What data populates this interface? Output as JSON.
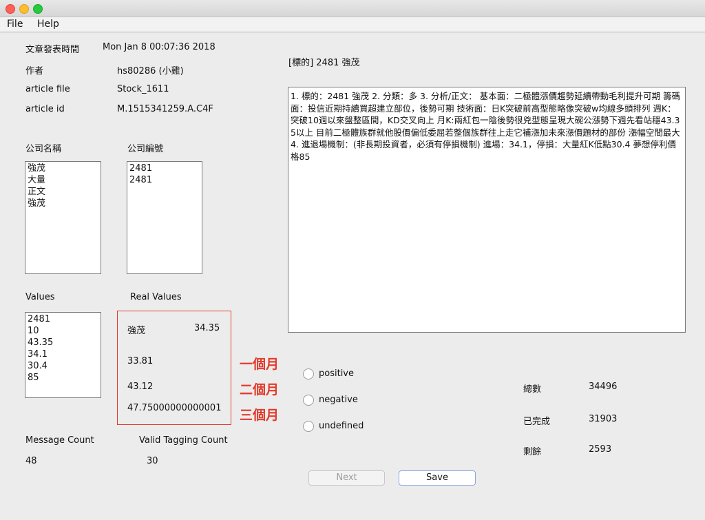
{
  "menu": {
    "file": "File",
    "help": "Help"
  },
  "meta": {
    "date_label": "文章發表時間",
    "date_value": "Mon Jan  8 00:07:36 2018",
    "author_label": "作者",
    "author_value": "hs80286 (小雞)",
    "file_label": "article file",
    "file_value": "Stock_1611",
    "id_label": "article id",
    "id_value": "M.1515341259.A.C4F"
  },
  "target": "[標的] 2481 強茂",
  "article_text": "1. 標的：2481 強茂 2. 分類：多 3. 分析/正文： 基本面：二極體漲價趨勢延續帶動毛利提升可期 籌碼面：投信近期持續買超建立部位，後勢可期 技術面：日K突破前高型態略像突破w均線多頭排列 週K：突破10週以來盤整區間，KD交叉向上 月K:兩紅包一陰後勢很兇型態呈現大碗公漲勢下週先看站穩43.35以上 目前二極體族群就他股價偏低委屈若整個族群往上走它補漲加未來漲價題材的部份 漲幅空間最大 4. 進退場機制：(非長期投資者，必須有停損機制) 進場：34.1，停損：大量紅K低點30.4 夢想停利價格85",
  "company_name_label": "公司名稱",
  "company_names": [
    "強茂",
    "大量",
    "正文",
    "強茂"
  ],
  "company_id_label": "公司編號",
  "company_ids": [
    "2481",
    "2481"
  ],
  "values_label": "Values",
  "values": [
    "2481",
    "10",
    "43.35",
    "34.1",
    "30.4",
    "85"
  ],
  "real_values_label": "Real Values",
  "real_values": {
    "company": "強茂",
    "base": "34.35",
    "month1": "33.81",
    "month2": "43.12",
    "month3": "47.75000000000001"
  },
  "annotations": {
    "month1": "一個月",
    "month2": "二個月",
    "month3": "三個月",
    "color": "#e23a2a"
  },
  "message_count_label": "Message Count",
  "message_count": "48",
  "valid_tagging_label": "Valid Tagging Count",
  "valid_tagging": "30",
  "sentiment": {
    "positive": "positive",
    "negative": "negative",
    "undefined": "undefined"
  },
  "stats": {
    "total_label": "總數",
    "total": "34496",
    "done_label": "已完成",
    "done": "31903",
    "remain_label": "剩餘",
    "remain": "2593"
  },
  "buttons": {
    "next": "Next",
    "save": "Save"
  }
}
